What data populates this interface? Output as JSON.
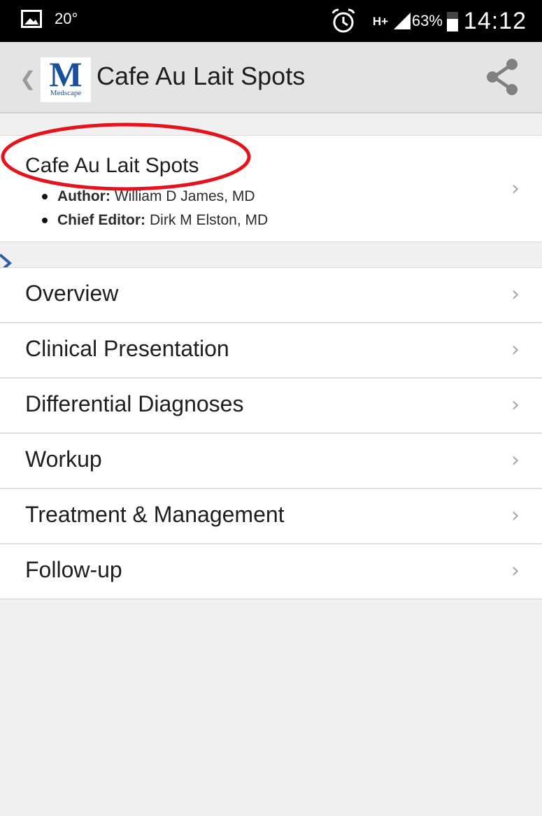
{
  "status_bar": {
    "temperature": "20°",
    "network": "H+",
    "battery_percent": "63%",
    "battery_level": 0.63,
    "time": "14:12"
  },
  "action_bar": {
    "logo_letter": "M",
    "logo_wordmark": "Medscape",
    "title": "Cafe Au Lait Spots"
  },
  "article": {
    "title": "Cafe Au Lait Spots",
    "credits": [
      {
        "label": "Author:",
        "name": "William D James, MD"
      },
      {
        "label": "Chief Editor:",
        "name": "Dirk M Elston, MD"
      }
    ]
  },
  "sections": [
    {
      "label": "Overview"
    },
    {
      "label": "Clinical Presentation"
    },
    {
      "label": "Differential Diagnoses"
    },
    {
      "label": "Workup"
    },
    {
      "label": "Treatment & Management"
    },
    {
      "label": "Follow-up"
    }
  ],
  "colors": {
    "annotation": "#e4141c",
    "brand": "#1a4fa0",
    "chevron": "#a8a8a8"
  },
  "icons": {
    "status_left": "gallery-icon",
    "status_alarm": "alarm-icon",
    "status_signal": "signal-icon",
    "status_battery": "battery-icon",
    "up_navigation": "chevron-left-icon",
    "share": "share-icon",
    "row_disclosure": "chevron-right-icon"
  }
}
